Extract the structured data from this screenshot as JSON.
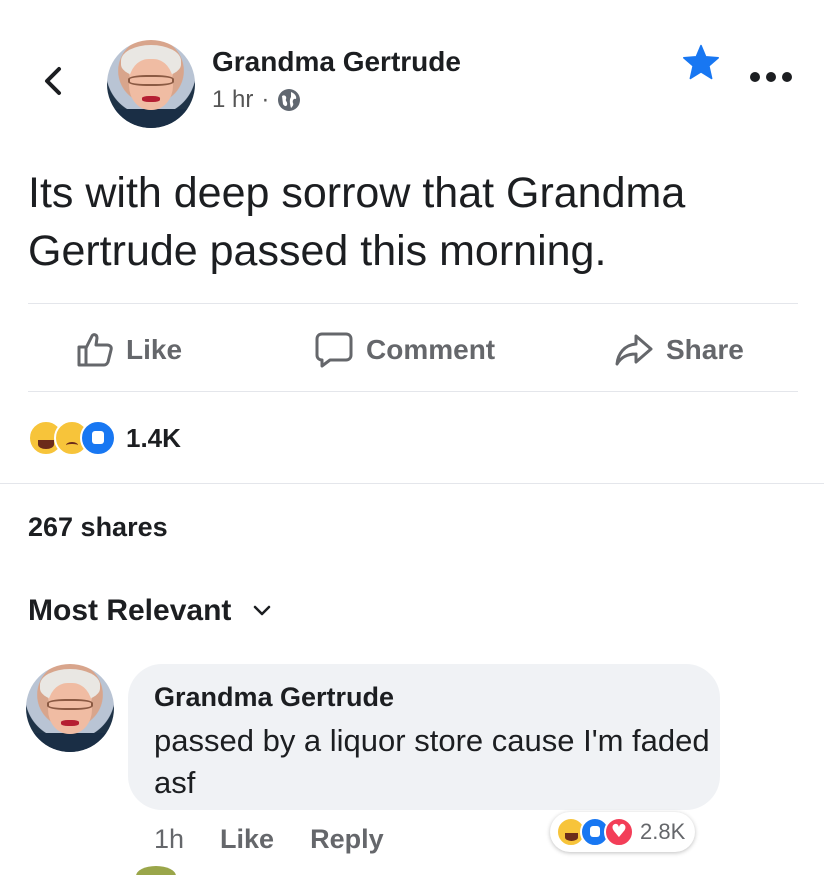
{
  "header": {
    "back_icon": "chevron-left-icon",
    "author": "Grandma Gertrude",
    "time": "1 hr",
    "separator": "·",
    "privacy_icon": "globe-icon",
    "star_icon": "star-icon",
    "more_icon": "more-dots-icon"
  },
  "post": {
    "text": "Its with deep sorrow that Grandma Gertrude passed this morning."
  },
  "actions": {
    "like": "Like",
    "comment": "Comment",
    "share": "Share"
  },
  "reactions": {
    "icons": [
      "haha-reaction",
      "sad-reaction",
      "like-reaction"
    ],
    "count": "1.4K"
  },
  "shares": "267 shares",
  "comments": {
    "sort_label": "Most Relevant",
    "items": [
      {
        "author": "Grandma Gertrude",
        "text": "passed by a liquor store cause I'm faded asf",
        "time": "1h",
        "like": "Like",
        "reply": "Reply",
        "reaction_icons": [
          "haha-reaction",
          "like-reaction",
          "love-reaction"
        ],
        "reaction_count": "2.8K"
      }
    ]
  },
  "colors": {
    "accent": "#1877f2",
    "secondary_text": "#65676b",
    "bubble": "#f0f2f5",
    "divider": "#e4e6eb"
  }
}
